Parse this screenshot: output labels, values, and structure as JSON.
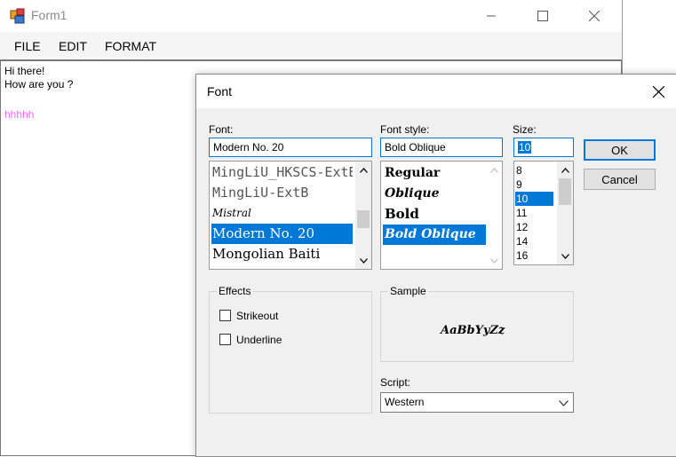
{
  "window": {
    "title": "Form1",
    "icon": "winforms-app-icon",
    "controls": [
      "minimize-icon",
      "maximize-icon",
      "close-icon"
    ]
  },
  "menu": {
    "items": [
      "FILE",
      "EDIT",
      "FORMAT"
    ]
  },
  "editor": {
    "lines": [
      "Hi there!",
      "How are you ?",
      "",
      "hhhhh"
    ],
    "highlight_color": "#ff66ff"
  },
  "font_dialog": {
    "title": "Font",
    "font_label": "Font:",
    "font_value": "Modern No. 20",
    "font_list": [
      "MingLiU_HKSCS-ExtB",
      "MingLiU-ExtB",
      "Mistral",
      "Modern No. 20",
      "Mongolian Baiti"
    ],
    "font_selected_index": 3,
    "style_label": "Font style:",
    "style_value": "Bold Oblique",
    "style_list": [
      "Regular",
      "Oblique",
      "Bold",
      "Bold Oblique"
    ],
    "style_selected_index": 3,
    "size_label": "Size:",
    "size_value": "10",
    "size_list": [
      "8",
      "9",
      "10",
      "11",
      "12",
      "14",
      "16"
    ],
    "size_selected_index": 2,
    "ok_label": "OK",
    "cancel_label": "Cancel",
    "effects_label": "Effects",
    "strikeout_label": "Strikeout",
    "strikeout_checked": false,
    "underline_label": "Underline",
    "underline_checked": false,
    "sample_label": "Sample",
    "sample_text": "AaBbYyZz",
    "script_label": "Script:",
    "script_value": "Western",
    "accent_color": "#0078d7"
  }
}
